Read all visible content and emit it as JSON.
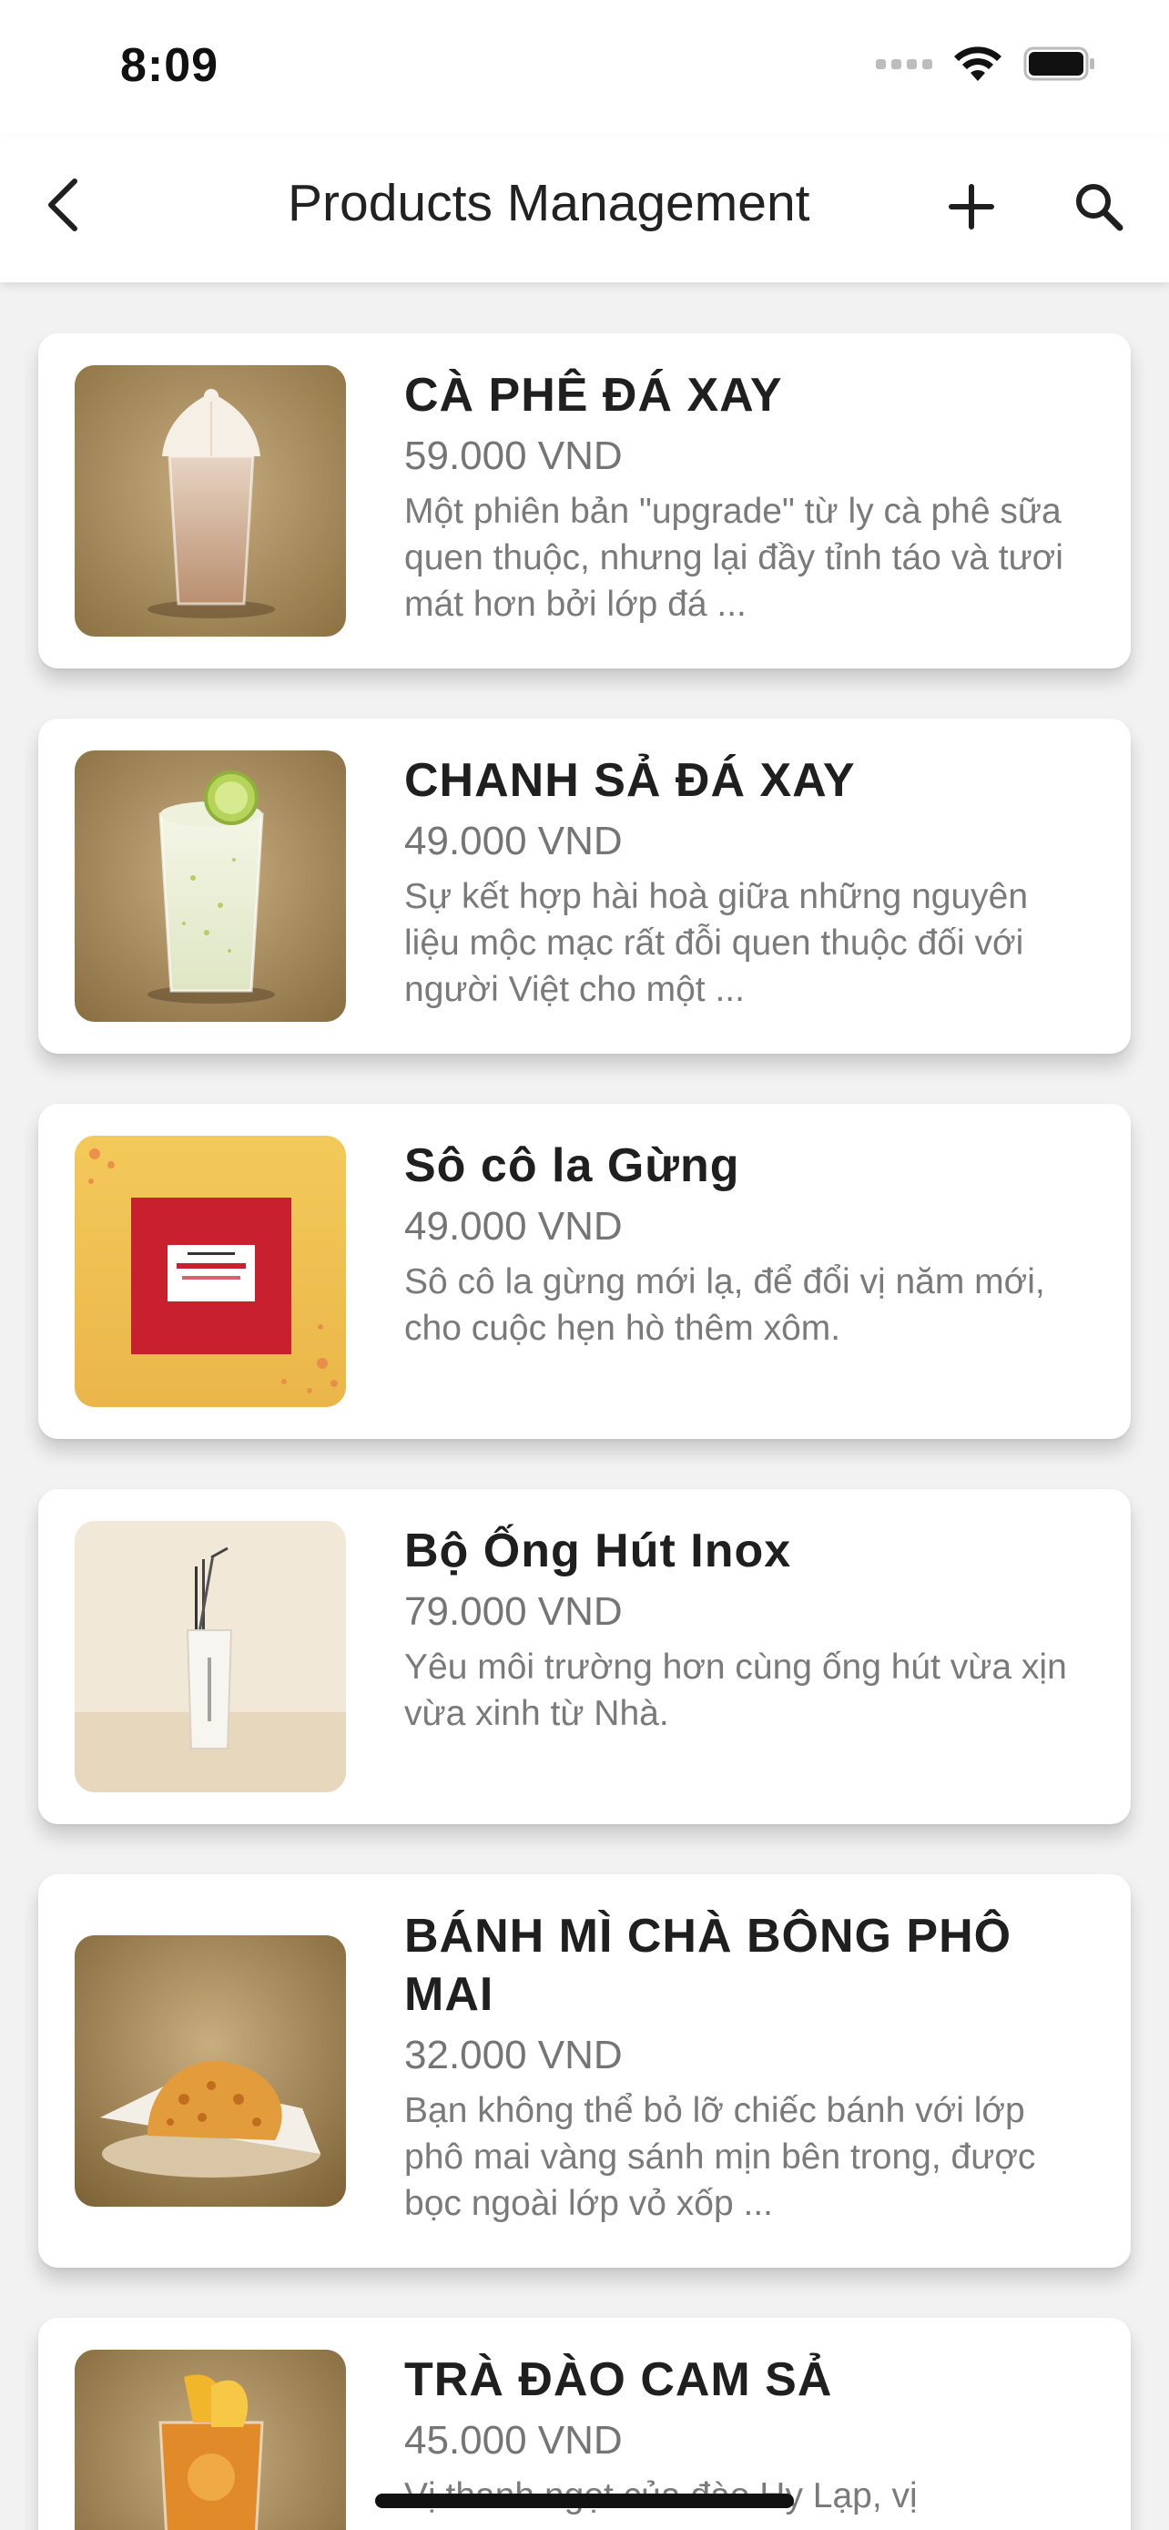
{
  "status_bar": {
    "time": "8:09"
  },
  "nav": {
    "title": "Products Management"
  },
  "products": [
    {
      "name": "CÀ PHÊ ĐÁ XAY",
      "price": "59.000 VND",
      "description": "Một phiên bản \"upgrade\" từ ly cà phê sữa quen thuộc, nhưng lại đầy tỉnh táo và tươi mát hơn bởi lớp đá ...",
      "image_icon": "blended-coffee-image"
    },
    {
      "name": "CHANH SẢ ĐÁ XAY",
      "price": "49.000 VND",
      "description": "Sự kết hợp hài hoà giữa những nguyên liệu mộc mạc rất đỗi quen thuộc đối với người Việt cho một ...",
      "image_icon": "lime-lemongrass-drink-image"
    },
    {
      "name": "Sô cô la Gừng",
      "price": "49.000 VND",
      "description": "Sô cô la gừng mới lạ, để đổi vị năm mới, cho cuộc hẹn hò thêm xôm.",
      "image_icon": "ginger-chocolate-box-image"
    },
    {
      "name": "Bộ Ống Hút Inox",
      "price": "79.000 VND",
      "description": "Yêu môi trường hơn cùng ống hút vừa xịn vừa xinh từ Nhà.",
      "image_icon": "steel-straw-set-image"
    },
    {
      "name": "BÁNH MÌ CHÀ BÔNG PHÔ MAI",
      "price": "32.000 VND",
      "description": "Bạn không thể bỏ lỡ chiếc bánh với lớp phô mai vàng sánh mịn bên trong, được bọc ngoài lớp vỏ xốp ...",
      "image_icon": "pork-floss-bread-image"
    },
    {
      "name": "TRÀ ĐÀO CAM SẢ",
      "price": "45.000 VND",
      "description": "Vị thanh ngọt của đào Hy Lạp, vị",
      "image_icon": "peach-tea-image"
    }
  ]
}
